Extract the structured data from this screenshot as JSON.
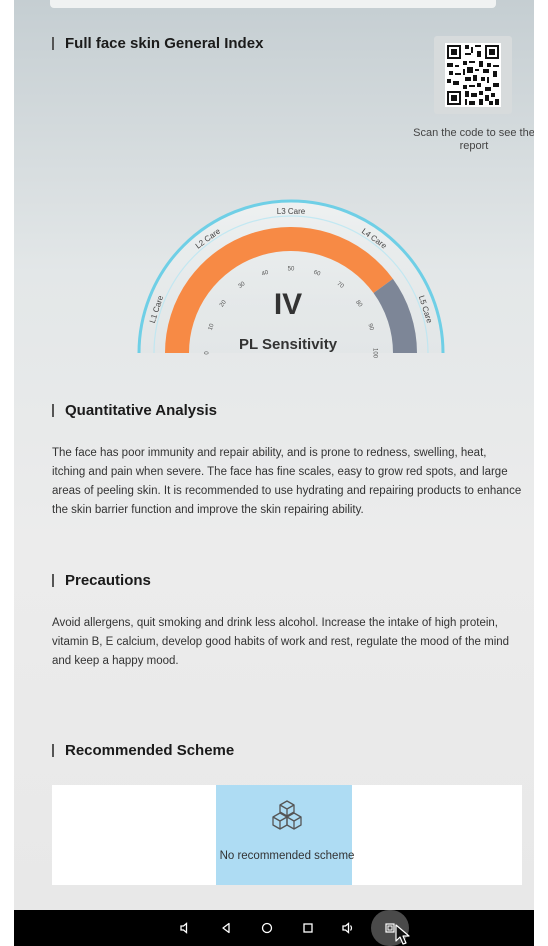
{
  "sections": {
    "general_index": {
      "title": "Full face skin General Index",
      "qr_caption": "Scan the code to see the report",
      "gauge": {
        "level_labels": [
          "L1 Care",
          "L2 Care",
          "L3 Care",
          "L4 Care",
          "L5 Care"
        ],
        "tick_labels": [
          "0",
          "10",
          "20",
          "30",
          "40",
          "50",
          "60",
          "70",
          "80",
          "90",
          "100"
        ],
        "value": 80,
        "grade": "IV",
        "sensitivity": "PL Sensitivity",
        "colors": {
          "outer_arc": "#6fcfe6",
          "filled_arc": "#f78a45",
          "remaining_arc": "#7d8697"
        }
      }
    },
    "quantitative": {
      "title": "Quantitative Analysis",
      "text": "The face has poor immunity and repair ability, and is prone to redness, swelling, heat, itching and pain when severe. The face has fine scales, easy to grow red spots, and large areas of peeling skin. It is recommended to use hydrating and repairing products to enhance the skin barrier function and improve the skin repairing ability."
    },
    "precautions": {
      "title": "Precautions",
      "text": "Avoid allergens, quit smoking and drink less alcohol. Increase the intake of high protein, vitamin B, E calcium, develop good habits of work and rest, regulate the mood of the mind and keep a happy mood."
    },
    "recommended": {
      "title": "Recommended Scheme",
      "icon": "boxes-icon",
      "empty_text": "No recommended scheme"
    }
  },
  "navbar": {
    "buttons": [
      "volume-down-icon",
      "back-icon",
      "home-icon",
      "recents-icon",
      "volume-up-icon",
      "screenshot-icon"
    ]
  }
}
